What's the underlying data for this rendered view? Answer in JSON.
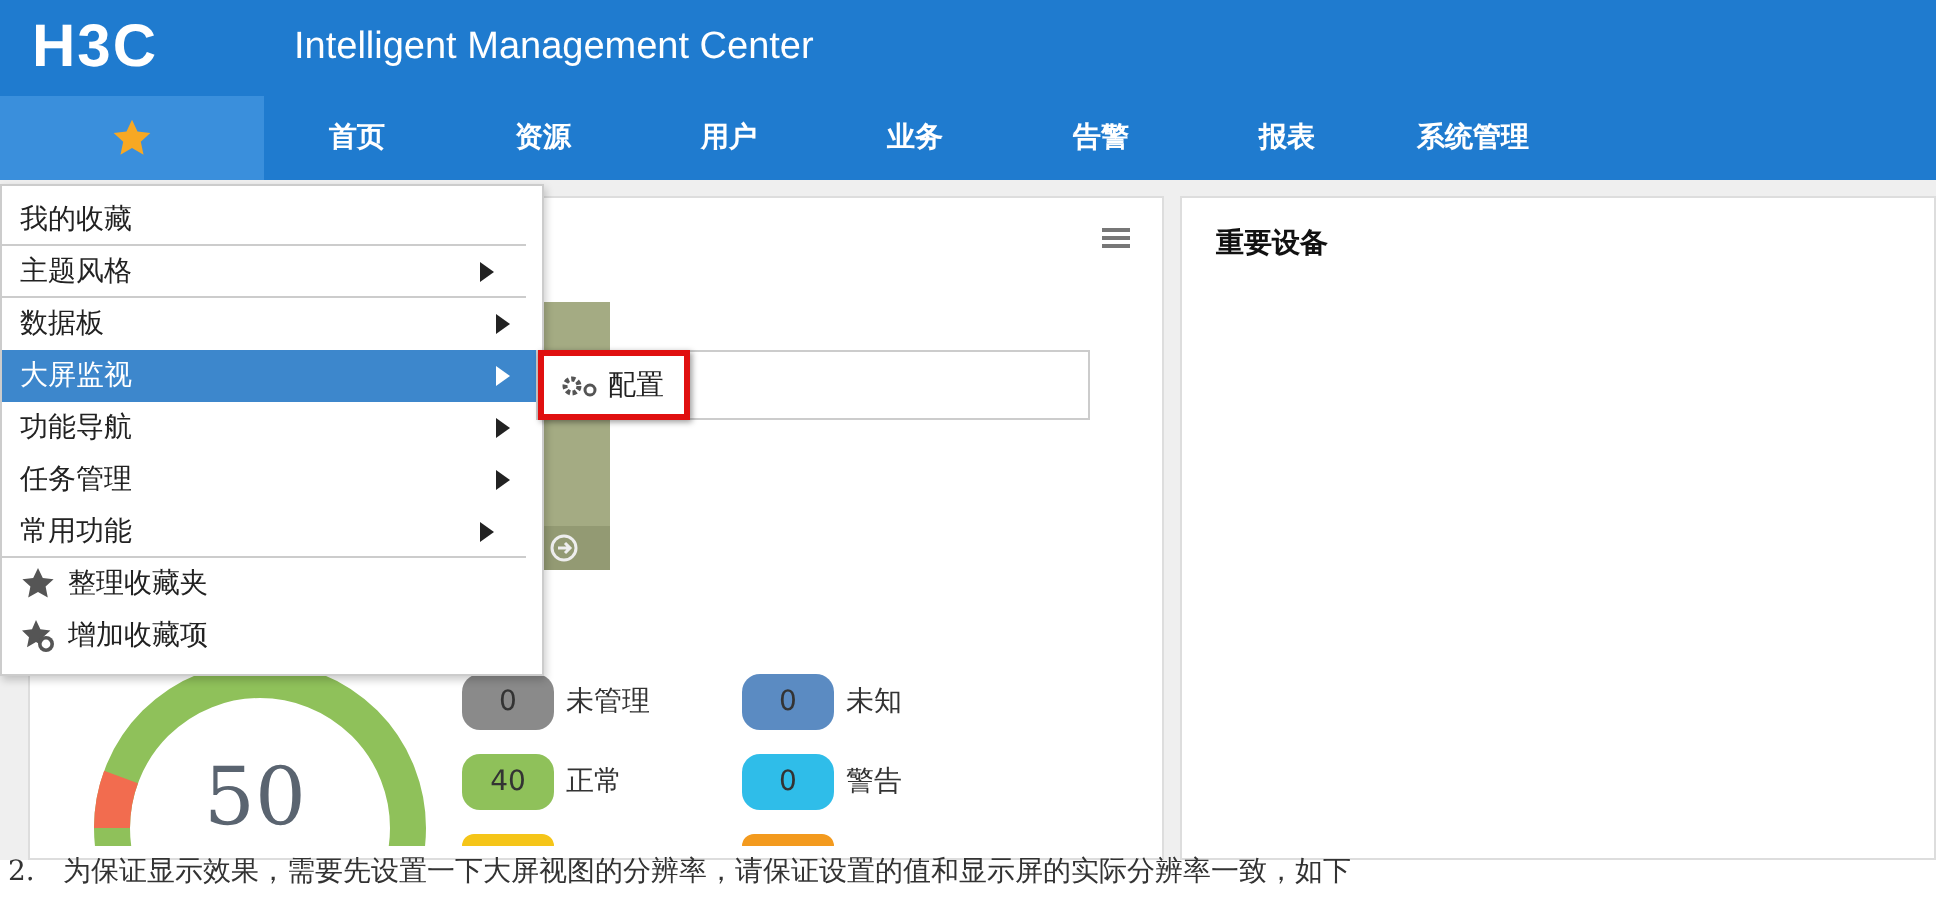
{
  "header": {
    "logo": "H3C",
    "title": "Intelligent Management Center"
  },
  "nav": [
    {
      "label": "首页",
      "selected": false
    },
    {
      "label": "资源",
      "selected": false
    },
    {
      "label": "用户",
      "selected": false
    },
    {
      "label": "业务",
      "selected": false
    },
    {
      "label": "告警",
      "selected": false
    },
    {
      "label": "报表",
      "selected": false
    },
    {
      "label": "系统管理",
      "selected": false
    }
  ],
  "favorites_menu": {
    "expanded": true,
    "items": [
      {
        "label": "我的收藏",
        "kind": "item",
        "selected": false,
        "separator": true
      },
      {
        "label": "主题风格",
        "kind": "submenu",
        "selected": false,
        "separator": true
      },
      {
        "label": "数据板",
        "kind": "submenu",
        "selected": false,
        "separator": false
      },
      {
        "label": "大屏监视",
        "kind": "submenu",
        "selected": true,
        "separator": false
      },
      {
        "label": "功能导航",
        "kind": "submenu",
        "selected": false,
        "separator": false
      },
      {
        "label": "任务管理",
        "kind": "submenu",
        "selected": false,
        "separator": false
      },
      {
        "label": "常用功能",
        "kind": "submenu",
        "selected": false,
        "separator": true
      },
      {
        "label": "整理收藏夹",
        "kind": "action",
        "selected": false,
        "separator": false
      },
      {
        "label": "增加收藏项",
        "kind": "action",
        "selected": false,
        "separator": false
      }
    ]
  },
  "submenu": {
    "items": [
      {
        "label": "配置",
        "highlighted": true
      }
    ]
  },
  "device_panel": {
    "gauge_value": "50",
    "legend": [
      {
        "count": "0",
        "label": "未管理",
        "color": "#8a8a8a"
      },
      {
        "count": "0",
        "label": "未知",
        "color": "#5b8bc2"
      },
      {
        "count": "40",
        "label": "正常",
        "color": "#8fc15a"
      },
      {
        "count": "0",
        "label": "警告",
        "color": "#2fbde9"
      }
    ]
  },
  "important_panel": {
    "title": "重要设备"
  },
  "caption": "2.　为保证显示效果，需要先设置一下大屏视图的分辨率，请保证设置的值和显示屏的实际分辨率一致，如下"
}
